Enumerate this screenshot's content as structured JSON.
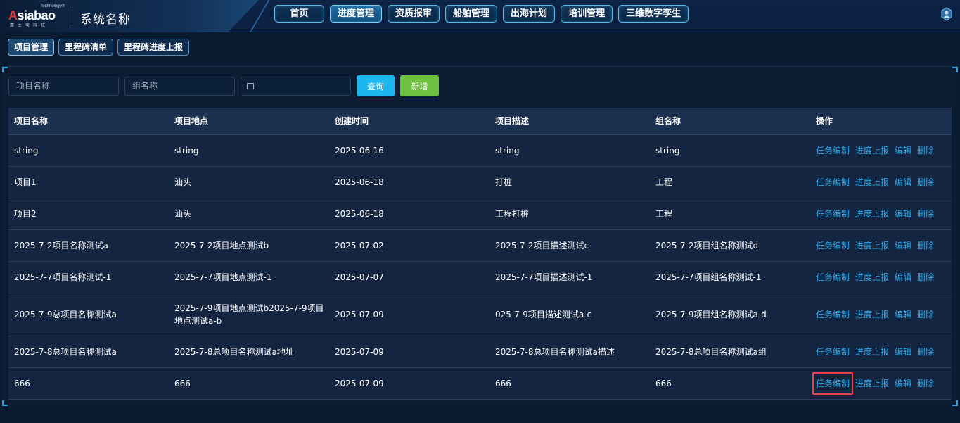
{
  "header": {
    "logo_tech": "Technology®",
    "logo_word_a": "A",
    "logo_word_rest": "siabao",
    "logo_sub": "嘉士宝科技",
    "system_title": "系统名称",
    "nav": [
      {
        "label": "首页",
        "active": false
      },
      {
        "label": "进度管理",
        "active": true
      },
      {
        "label": "资质报审",
        "active": false
      },
      {
        "label": "船舶管理",
        "active": false
      },
      {
        "label": "出海计划",
        "active": false
      },
      {
        "label": "培训管理",
        "active": false
      },
      {
        "label": "三维数字孪生",
        "active": false
      }
    ]
  },
  "subtabs": [
    "项目管理",
    "里程碑清单",
    "里程碑进度上报"
  ],
  "filters": {
    "project_name_placeholder": "项目名称",
    "group_name_placeholder": "组名称",
    "query_label": "查询",
    "add_label": "新增"
  },
  "table": {
    "headers": [
      "项目名称",
      "项目地点",
      "创建时间",
      "项目描述",
      "组名称",
      "操作"
    ],
    "actions": [
      "任务编制",
      "进度上报",
      "编辑",
      "删除"
    ],
    "rows": [
      [
        "string",
        "string",
        "2025-06-16",
        "string",
        "string"
      ],
      [
        "项目1",
        "汕头",
        "2025-06-18",
        "打桩",
        "工程"
      ],
      [
        "项目2",
        "汕头",
        "2025-06-18",
        "工程打桩",
        "工程"
      ],
      [
        "2025-7-2项目名称测试a",
        "2025-7-2项目地点测试b",
        "2025-07-02",
        "2025-7-2项目描述测试c",
        "2025-7-2项目组名称测试d"
      ],
      [
        "2025-7-7项目名称测试-1",
        "2025-7-7项目地点测试-1",
        "2025-07-07",
        "2025-7-7项目描述测试-1",
        "2025-7-7项目组名称测试-1"
      ],
      [
        "2025-7-9总项目名称测试a",
        "2025-7-9项目地点测试b2025-7-9项目地点测试a-b",
        "2025-07-09",
        "025-7-9项目描述测试a-c",
        "2025-7-9项目组名称测试a-d"
      ],
      [
        "2025-7-8总项目名称测试a",
        "2025-7-8总项目名称测试a地址",
        "2025-07-09",
        "2025-7-8总项目名称测试a描述",
        "2025-7-8总项目名称测试a组"
      ],
      [
        "666",
        "666",
        "2025-07-09",
        "666",
        "666"
      ]
    ]
  },
  "colors": {
    "accent": "#1eb6ee",
    "add": "#6dc13f",
    "link": "#2aa7e8",
    "highlight": "#e74545"
  }
}
